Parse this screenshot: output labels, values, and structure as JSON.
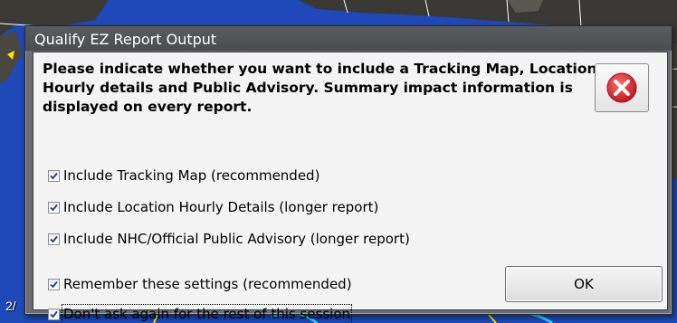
{
  "window": {
    "title": "Qualify EZ Report Output"
  },
  "instructions": "Please indicate whether you want to include a Tracking Map, Location Hourly details and Public Advisory.  Summary impact information is displayed on every report.",
  "options": [
    {
      "label": "Include Tracking Map (recommended)",
      "checked": true
    },
    {
      "label": "Include Location Hourly Details (longer report)",
      "checked": true
    },
    {
      "label": "Include NHC/Official Public Advisory (longer report)",
      "checked": true
    },
    {
      "label": "Remember these settings (recommended)",
      "checked": true
    },
    {
      "label": "Don't ask again for the rest of this session",
      "checked": true
    }
  ],
  "buttons": {
    "ok_label": "OK",
    "close_icon": "red-x-close-icon"
  },
  "background": {
    "caption": "2/",
    "map_color": "#1f49b8"
  },
  "colors": {
    "close_red": "#d6282c",
    "dialog_frame": "#6b6d70",
    "client_bg": "#f4f4f4"
  }
}
